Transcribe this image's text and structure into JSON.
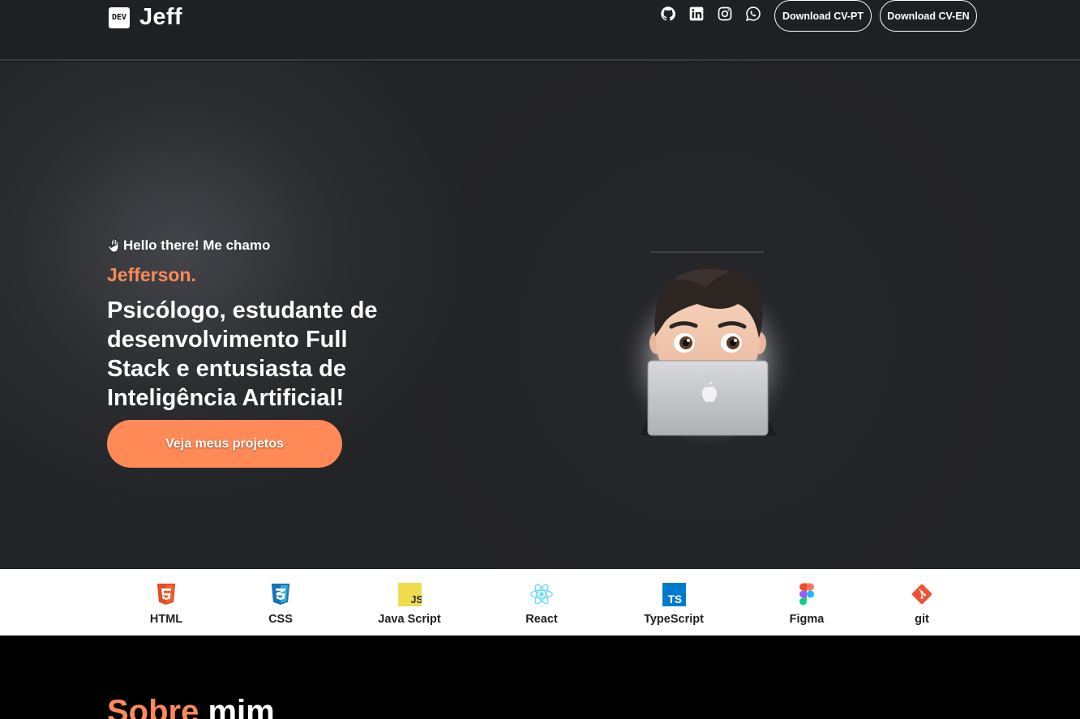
{
  "header": {
    "logo_badge": "DEV",
    "brand_name": "Jeff",
    "socials": [
      "github-icon",
      "linkedin-icon",
      "instagram-icon",
      "whatsapp-icon"
    ],
    "cv_pt_label": "Download CV-PT",
    "cv_en_label": "Download CV-EN"
  },
  "hero": {
    "greeting": "Hello there! Me chamo",
    "name": "Jefferson.",
    "headline": "Psicólogo, estudante de desenvolvimento Full Stack e entusiasta de Inteligência Artificial!",
    "cta_label": "Veja meus projetos"
  },
  "skills": [
    {
      "label": "HTML",
      "icon": "html5-icon"
    },
    {
      "label": "CSS",
      "icon": "css3-icon"
    },
    {
      "label": "Java Script",
      "icon": "javascript-icon"
    },
    {
      "label": "React",
      "icon": "react-icon"
    },
    {
      "label": "TypeScript",
      "icon": "typescript-icon"
    },
    {
      "label": "Figma",
      "icon": "figma-icon"
    },
    {
      "label": "git",
      "icon": "git-icon"
    }
  ],
  "about": {
    "title_accent": "Sobre",
    "title_rest": "mim"
  },
  "colors": {
    "accent": "#ff8a57",
    "background": "#1e1f23"
  }
}
